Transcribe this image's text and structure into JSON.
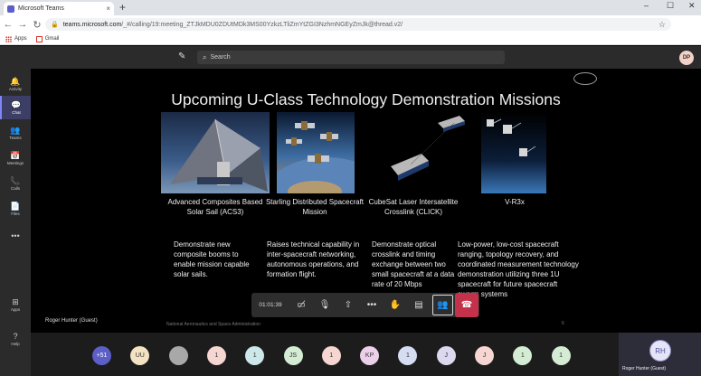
{
  "browser": {
    "tab_title": "Microsoft Teams",
    "tab_close": "×",
    "new_tab": "+",
    "win_min": "–",
    "win_max": "☐",
    "win_close": "✕",
    "url_host": "teams.microsoft.com",
    "url_path": "/_#/calling/19:meeting_ZTJkMDU0ZDUtMDk3MS00YzkzLTliZmYtZGI3NzhmNGEyZmJk@thread.v2/",
    "bookmarks": [
      "Apps",
      "Gmail"
    ]
  },
  "teams": {
    "search_placeholder": "Search",
    "me_initials": "DP"
  },
  "rail": [
    {
      "label": "Activity",
      "icon": "bell-icon",
      "glyph": "🔔"
    },
    {
      "label": "Chat",
      "icon": "chat-icon",
      "glyph": "💬"
    },
    {
      "label": "Teams",
      "icon": "teams-icon",
      "glyph": "👥"
    },
    {
      "label": "Meetings",
      "icon": "calendar-icon",
      "glyph": "📅"
    },
    {
      "label": "Calls",
      "icon": "phone-icon",
      "glyph": "📞"
    },
    {
      "label": "Files",
      "icon": "file-icon",
      "glyph": "📄"
    },
    {
      "label": "",
      "icon": "more-icon",
      "glyph": "•••"
    },
    {
      "label": "Apps",
      "icon": "apps-icon",
      "glyph": "⊞"
    },
    {
      "label": "Help",
      "icon": "help-icon",
      "glyph": "?"
    }
  ],
  "slide": {
    "title": "Upcoming U-Class Technology Demonstration Missions",
    "missions": [
      {
        "name": "Advanced Composites Based Solar Sail (ACS3)",
        "desc": "Demonstrate new composite booms to enable mission capable solar sails."
      },
      {
        "name": "Starling Distributed Spacecraft Mission",
        "desc": "Raises technical capability in inter-spacecraft networking, autonomous operations, and formation flight."
      },
      {
        "name": "CubeSat Laser Intersatellite Crosslink (CLICK)",
        "desc": "Demonstrate optical crosslink and timing exchange between two small spacecraft at a data rate of 20 Mbps"
      },
      {
        "name": "V-R3x",
        "desc": "Low-power, low-cost spacecraft ranging, topology recovery, and coordinated measurement technology demonstration utilizing three 1U spacecraft for future spacecraft swarm systems"
      }
    ],
    "presenter": "Roger Hunter (Guest)",
    "footer": "National Aeronautics and Space Administration",
    "page": "6"
  },
  "call": {
    "timer": "01:01:39"
  },
  "participants": [
    {
      "label": "+51",
      "color": "#5b5fc7",
      "text": "#ffffff"
    },
    {
      "label": "UU",
      "color": "#f3e3c3"
    },
    {
      "label": "",
      "color": "#a8a8a8"
    },
    {
      "label": "1",
      "color": "#f6d6d1"
    },
    {
      "label": "1",
      "color": "#cde8ea"
    },
    {
      "label": "JS",
      "color": "#d3ecd3"
    },
    {
      "label": "1",
      "color": "#f6d6d1"
    },
    {
      "label": "KP",
      "color": "#ecd0ea"
    },
    {
      "label": "1",
      "color": "#d5ddf2"
    },
    {
      "label": "J",
      "color": "#dcd8f0"
    },
    {
      "label": "J",
      "color": "#f6d6d1"
    },
    {
      "label": "1",
      "color": "#d3ecd3"
    },
    {
      "label": "1",
      "color": "#d3ecd3"
    }
  ],
  "self": {
    "initials": "RH",
    "name": "Roger Hunter (Guest)"
  }
}
